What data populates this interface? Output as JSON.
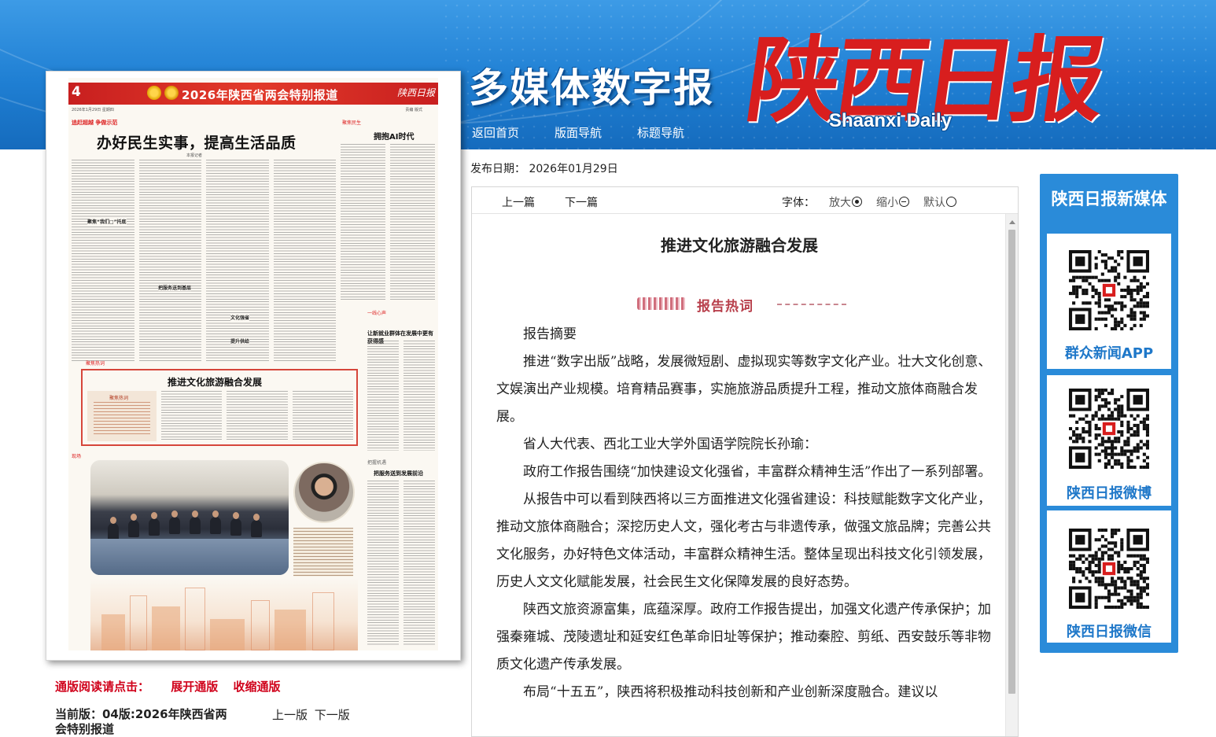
{
  "header": {
    "multimedia_title": "多媒体数字报",
    "logo_cn": "陕西日报",
    "logo_en": "Shaanxi Daily",
    "nav": [
      "返回首页",
      "版面导航",
      "标题导航"
    ]
  },
  "newspaper_page": {
    "page_number": "4",
    "banner_title": "2026年陕西省两会特别报道",
    "masthead_mark": "陕西日报",
    "date_line": "2026年1月29日  星期四",
    "date_line_right": "责编 版式",
    "top_kicker": "追赶超越  争做示范",
    "headline": "办好民生实事，提高生活品质",
    "byline": "本报记者",
    "side_kicker": "聚焦民生",
    "side_headline": "拥抱AI时代",
    "sub_headings": [
      "聚焦“我们□”托底",
      "把服务送到基层",
      "文化强省",
      "提升供给"
    ],
    "mid_kicker": "一线心声",
    "mid_headline": "让新就业群体在发展中更有获得感",
    "feature_kicker": "聚焦热词",
    "feature_headline": "推进文化旅游融合发展",
    "feature_box_title": "聚焦热词",
    "photo_kicker": "现场",
    "right_kicker": "把握机遇",
    "right_headline": "把服务送到发展前沿"
  },
  "controls": {
    "reading_label": "通版阅读请点击：",
    "expand": "展开通版",
    "collapse": "收缩通版",
    "current_edition": "当前版：04版:2026年陕西省两会特别报道",
    "prev_edition": "上一版",
    "next_edition": "下一版"
  },
  "article": {
    "publish_date": "发布日期：  2026年01月29日",
    "prev": "上一篇",
    "next": "下一篇",
    "font_label": "字体：",
    "font_larger": "放大",
    "font_smaller": "缩小",
    "font_default": "默认",
    "title": "推进文化旅游融合发展",
    "hot_words": "报告热词",
    "paragraphs": [
      "报告摘要",
      "推进“数字出版”战略，发展微短剧、虚拟现实等数字文化产业。壮大文化创意、文娱演出产业规模。培育精品赛事，实施旅游品质提升工程，推动文旅体商融合发展。",
      "省人大代表、西北工业大学外国语学院院长孙瑜：",
      "政府工作报告围绕“加快建设文化强省，丰富群众精神生活”作出了一系列部署。",
      "从报告中可以看到陕西将以三方面推进文化强省建设：科技赋能数字文化产业，推动文旅体商融合；深挖历史人文，强化考古与非遗传承，做强文旅品牌；完善公共文化服务，办好特色文体活动，丰富群众精神生活。整体呈现出科技文化引领发展，历史人文文化赋能发展，社会民生文化保障发展的良好态势。",
      "陕西文旅资源富集，底蕴深厚。政府工作报告提出，加强文化遗产传承保护；加强秦雍城、茂陵遗址和延安红色革命旧址等保护；推动秦腔、剪纸、西安鼓乐等非物质文化遗产传承发展。",
      "布局“十五五”，陕西将积极推动科技创新和产业创新深度融合。建议以"
    ]
  },
  "sidebar": {
    "title": "陕西日报新媒体",
    "items": [
      {
        "label": "群众新闻APP",
        "icon": "qr-code-icon"
      },
      {
        "label": "陕西日报微博",
        "icon": "qr-code-icon"
      },
      {
        "label": "陕西日报微信",
        "icon": "qr-code-icon"
      }
    ]
  },
  "colors": {
    "header_blue": "#1f7fd3",
    "logo_red": "#d81e1e",
    "link_red": "#d0021b",
    "sidebar_blue": "#2a8bd9",
    "sidebar_label_blue": "#1f78c9"
  }
}
